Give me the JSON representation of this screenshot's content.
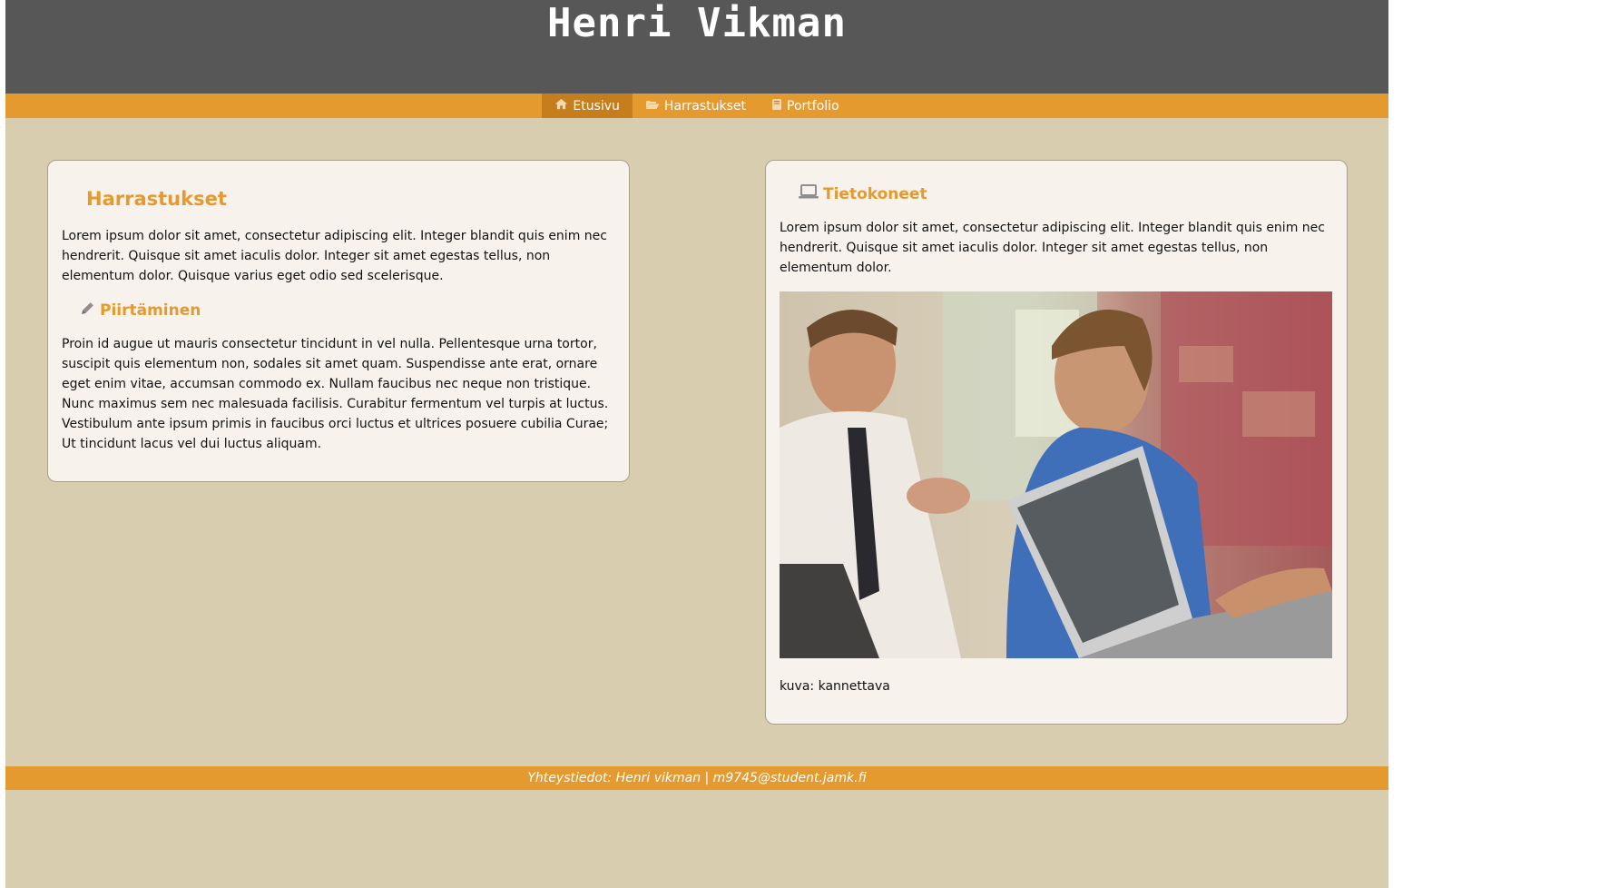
{
  "header": {
    "title": "Henri Vikman"
  },
  "nav": {
    "items": [
      {
        "label": "Etusivu",
        "icon": "home-icon",
        "active": true
      },
      {
        "label": "Harrastukset",
        "icon": "folder-open-icon",
        "active": false
      },
      {
        "label": "Portfolio",
        "icon": "book-icon",
        "active": false
      }
    ]
  },
  "left_card": {
    "heading": "Harrastukset",
    "intro": "Lorem ipsum dolor sit amet, consectetur adipiscing elit. Integer blandit quis enim nec hendrerit. Quisque sit amet iaculis dolor. Integer sit amet egestas tellus, non elementum dolor. Quisque varius eget odio sed scelerisque.",
    "sub_heading": "Piirtäminen",
    "sub_icon": "pencil-icon",
    "body": "Proin id augue ut mauris consectetur tincidunt in vel nulla. Pellentesque urna tortor, suscipit quis elementum non, sodales sit amet quam. Suspendisse ante erat, ornare eget enim vitae, accumsan commodo ex. Nullam faucibus nec neque non tristique. Nunc maximus sem nec malesuada facilisis. Curabitur fermentum vel turpis at luctus. Vestibulum ante ipsum primis in faucibus orci luctus et ultrices posuere cubilia Curae; Ut tincidunt lacus vel dui luctus aliquam."
  },
  "right_card": {
    "heading": "Tietokoneet",
    "heading_icon": "laptop-icon",
    "intro": "Lorem ipsum dolor sit amet, consectetur adipiscing elit. Integer blandit quis enim nec hendrerit. Quisque sit amet iaculis dolor. Integer sit amet egestas tellus, non elementum dolor.",
    "caption": "kuva: kannettava"
  },
  "footer": {
    "text": "Yhteystiedot: Henri vikman | m9745@student.jamk.fi"
  },
  "colors": {
    "accent": "#e59a30",
    "header_bg": "#575757",
    "page_bg": "#d8cdae",
    "card_bg": "#f7f3ec"
  }
}
